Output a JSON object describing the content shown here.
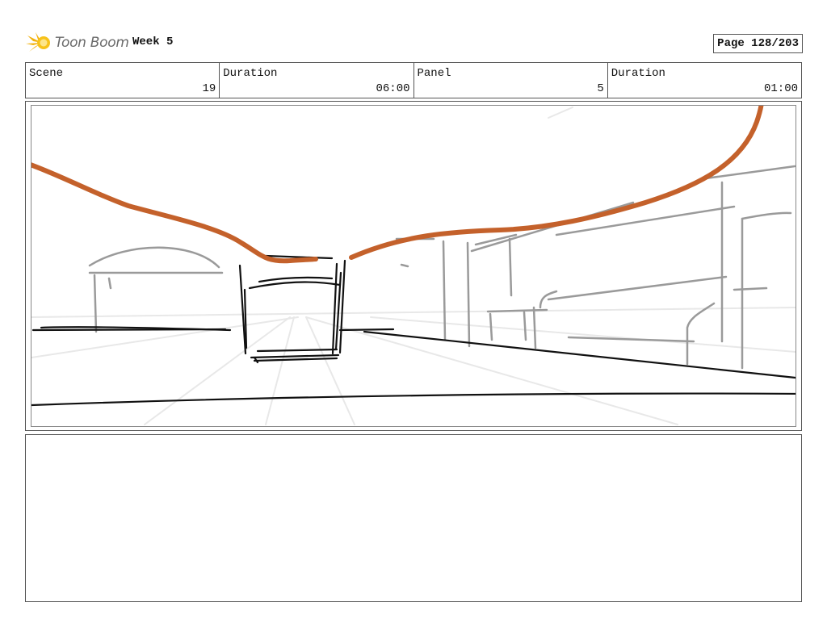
{
  "header": {
    "logo_text": "Toon Boom",
    "title": "Week 5",
    "page": "Page 128/203"
  },
  "info": {
    "scene_label": "Scene",
    "scene_value": "19",
    "duration_label": "Duration",
    "duration_value": "06:00",
    "panel_label": "Panel",
    "panel_value": "5",
    "panel_duration_label": "Duration",
    "panel_duration_value": "01:00"
  },
  "panel": {
    "sketch_colors": {
      "line_black": "#111111",
      "line_grey": "#9a9a9a",
      "line_light": "#e6e6e6",
      "accent_orange": "#c4612b"
    }
  },
  "notes": {
    "text": ""
  }
}
